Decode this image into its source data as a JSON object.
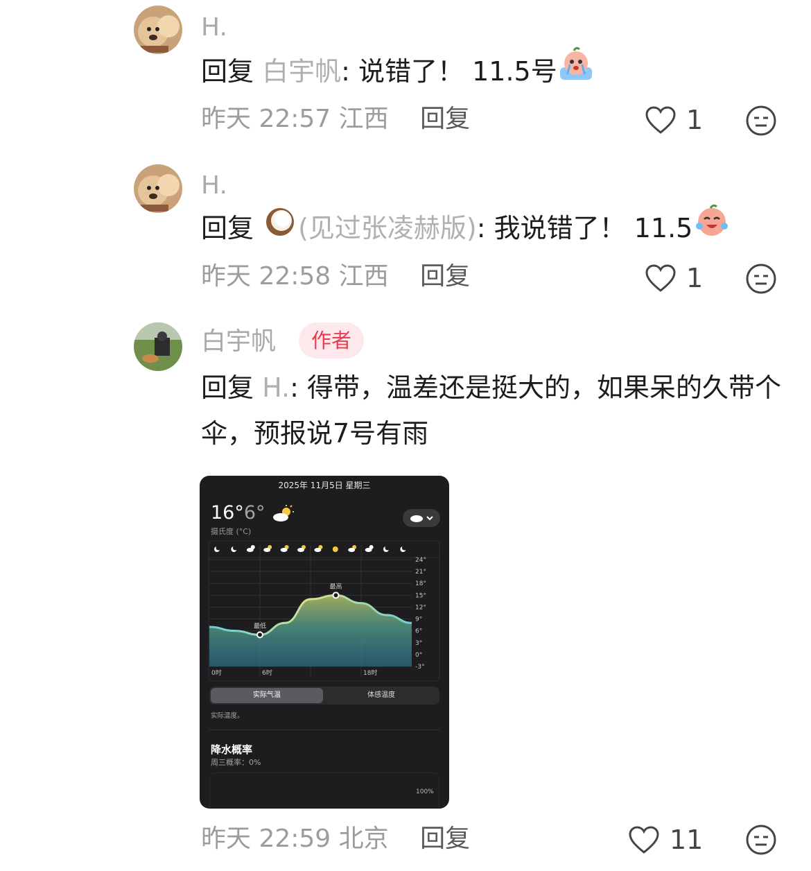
{
  "comments": [
    {
      "username": "H.",
      "reply_prefix": "回复",
      "reply_target": "白宇帆",
      "reply_text": ": 说错了！ 11.5号",
      "time": "昨天 22:57",
      "location": "江西",
      "reply_label": "回复",
      "likes": "1",
      "emoji": "crying-peach-emoji"
    },
    {
      "username": "H.",
      "reply_prefix": "回复",
      "reply_target": "(见过张凌赫版)",
      "reply_text": ": 我说错了！ 11.5",
      "time": "昨天 22:58",
      "location": "江西",
      "reply_label": "回复",
      "likes": "1",
      "emoji": "laughing-crying-peach-emoji",
      "target_icon": "coconut-icon"
    },
    {
      "username": "白宇帆",
      "badge": "作者",
      "reply_prefix": "回复",
      "reply_target": "H.",
      "reply_text": ": 得带，温差还是挺大的，如果呆的久带个伞，预报说7号有雨",
      "time": "昨天 22:59",
      "location": "北京",
      "reply_label": "回复",
      "likes": "11"
    }
  ],
  "weather_screenshot": {
    "date": "2025年 11月5日 星期三",
    "high": "16°",
    "low": "6°",
    "unit": "摄氏度 (°C)",
    "tab_active": "实际气温",
    "tab_inactive": "体感温度",
    "caption": "实际温度。",
    "precip_title": "降水概率",
    "precip_sub": "周三概率：0%",
    "precip_axis": "100%",
    "chart_data": {
      "type": "area",
      "x": [
        0,
        3,
        6,
        9,
        12,
        15,
        18,
        21,
        24
      ],
      "y": [
        7,
        6,
        5,
        8,
        14,
        15,
        13,
        10,
        8
      ],
      "x_tick_labels": [
        "0时",
        "6时",
        "18时"
      ],
      "y_tick_labels": [
        "24°",
        "21°",
        "18°",
        "15°",
        "12°",
        "9°",
        "6°",
        "3°",
        "0°",
        "-3°"
      ],
      "ylim": [
        -3,
        24
      ],
      "annotations": [
        {
          "label": "最低",
          "x": 6,
          "y": 5
        },
        {
          "label": "最高",
          "x": 15,
          "y": 15
        }
      ]
    }
  }
}
